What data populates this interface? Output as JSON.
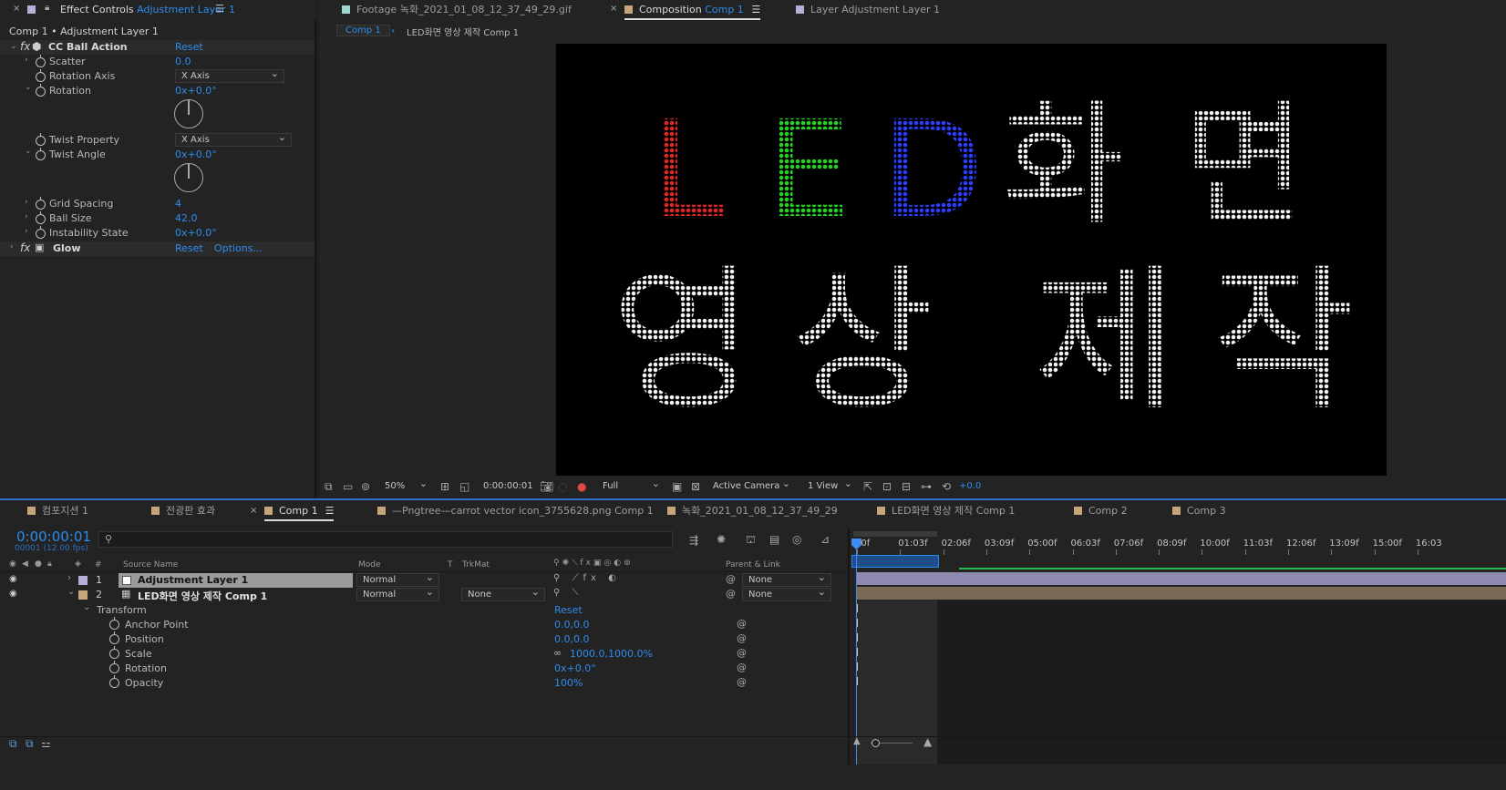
{
  "effect_controls": {
    "tab_prefix": "Effect Controls",
    "tab_layer": "Adjustment Layer 1",
    "breadcrumb": "Comp 1 • Adjustment Layer 1",
    "cc_ball_action": {
      "name": "CC Ball Action",
      "reset": "Reset",
      "props": [
        {
          "label": "Scatter",
          "value": "0.0"
        },
        {
          "label": "Rotation Axis",
          "value": "X Axis"
        },
        {
          "label": "Rotation",
          "value": "0x+0.0°"
        },
        {
          "label": "Twist Property",
          "value": "X Axis"
        },
        {
          "label": "Twist Angle",
          "value": "0x+0.0°"
        },
        {
          "label": "Grid Spacing",
          "value": "4"
        },
        {
          "label": "Ball Size",
          "value": "42.0"
        },
        {
          "label": "Instability State",
          "value": "0x+0.0°"
        }
      ]
    },
    "glow": {
      "name": "Glow",
      "reset": "Reset",
      "options": "Options..."
    }
  },
  "viewer_tabs": [
    {
      "prefix": "Footage",
      "name": "녹화_2021_01_08_12_37_49_29.gif",
      "color": "#9fd7d2"
    },
    {
      "prefix": "Composition",
      "name": "Comp 1",
      "color": "#c7a57a"
    },
    {
      "prefix": "Layer",
      "name": "Adjustment Layer 1",
      "color": "#b6b0d8"
    }
  ],
  "comp_breadcrumb": {
    "current": "Comp 1",
    "parent_name": "LED화면 영상 제작",
    "parent_comp": "Comp 1"
  },
  "led_display": {
    "line1": [
      {
        "char": "L",
        "color": "#e62424"
      },
      {
        "char": "E",
        "color": "#22d322"
      },
      {
        "char": "D",
        "color": "#2c3dff"
      },
      {
        "char": "화",
        "color": "#f2f2f2"
      },
      {
        "char": "면",
        "color": "#f2f2f2"
      }
    ],
    "line2": [
      "영",
      "상",
      "제",
      "작"
    ]
  },
  "viewer_toolbar": {
    "zoom": "50%",
    "timecode": "0:00:00:01",
    "resolution": "Full",
    "camera": "Active Camera",
    "views": "1 View",
    "exposure": "+0.0"
  },
  "timeline_tabs": [
    {
      "name": "컴포지션 1",
      "color": "#c7a57a"
    },
    {
      "name": "전광판 효과",
      "color": "#c7a57a"
    },
    {
      "name": "Comp 1",
      "color": "#c7a57a"
    },
    {
      "name": "—Pngtree—carrot vector icon_3755628.png Comp 1",
      "color": "#c7a57a"
    },
    {
      "name": "녹화_2021_01_08_12_37_49_29",
      "color": "#c7a57a"
    },
    {
      "name": "LED화면 영상 제작 Comp 1",
      "color": "#c7a57a"
    },
    {
      "name": "Comp 2",
      "color": "#c7a57a"
    },
    {
      "name": "Comp 3",
      "color": "#c7a57a"
    }
  ],
  "timeline": {
    "timecode": "0:00:00:01",
    "frame_info": "00001 (12.00 fps)",
    "search_placeholder": "",
    "columns": {
      "num": "#",
      "source": "Source Name",
      "mode": "Mode",
      "t": "T",
      "trkmat": "TrkMat",
      "parent": "Parent & Link"
    },
    "layers": [
      {
        "num": "1",
        "name": "Adjustment Layer 1",
        "mode": "Normal",
        "trkmat": "",
        "parent": "None",
        "color": "#b6b0d8"
      },
      {
        "num": "2",
        "name": "LED화면 영상 제작 Comp 1",
        "mode": "Normal",
        "trkmat": "None",
        "parent": "None",
        "color": "#c7a57a"
      }
    ],
    "transform": {
      "label": "Transform",
      "reset": "Reset",
      "props": [
        {
          "label": "Anchor Point",
          "value": "0.0,0.0"
        },
        {
          "label": "Position",
          "value": "0.0,0.0"
        },
        {
          "label": "Scale",
          "value": "1000.0,1000.0%"
        },
        {
          "label": "Rotation",
          "value": "0x+0.0°"
        },
        {
          "label": "Opacity",
          "value": "100%"
        }
      ]
    },
    "ruler": [
      "00f",
      "01:03f",
      "02:06f",
      "03:09f",
      "05:00f",
      "06:03f",
      "07:06f",
      "08:09f",
      "10:00f",
      "11:03f",
      "12:06f",
      "13:09f",
      "15:00f",
      "16:03"
    ]
  }
}
